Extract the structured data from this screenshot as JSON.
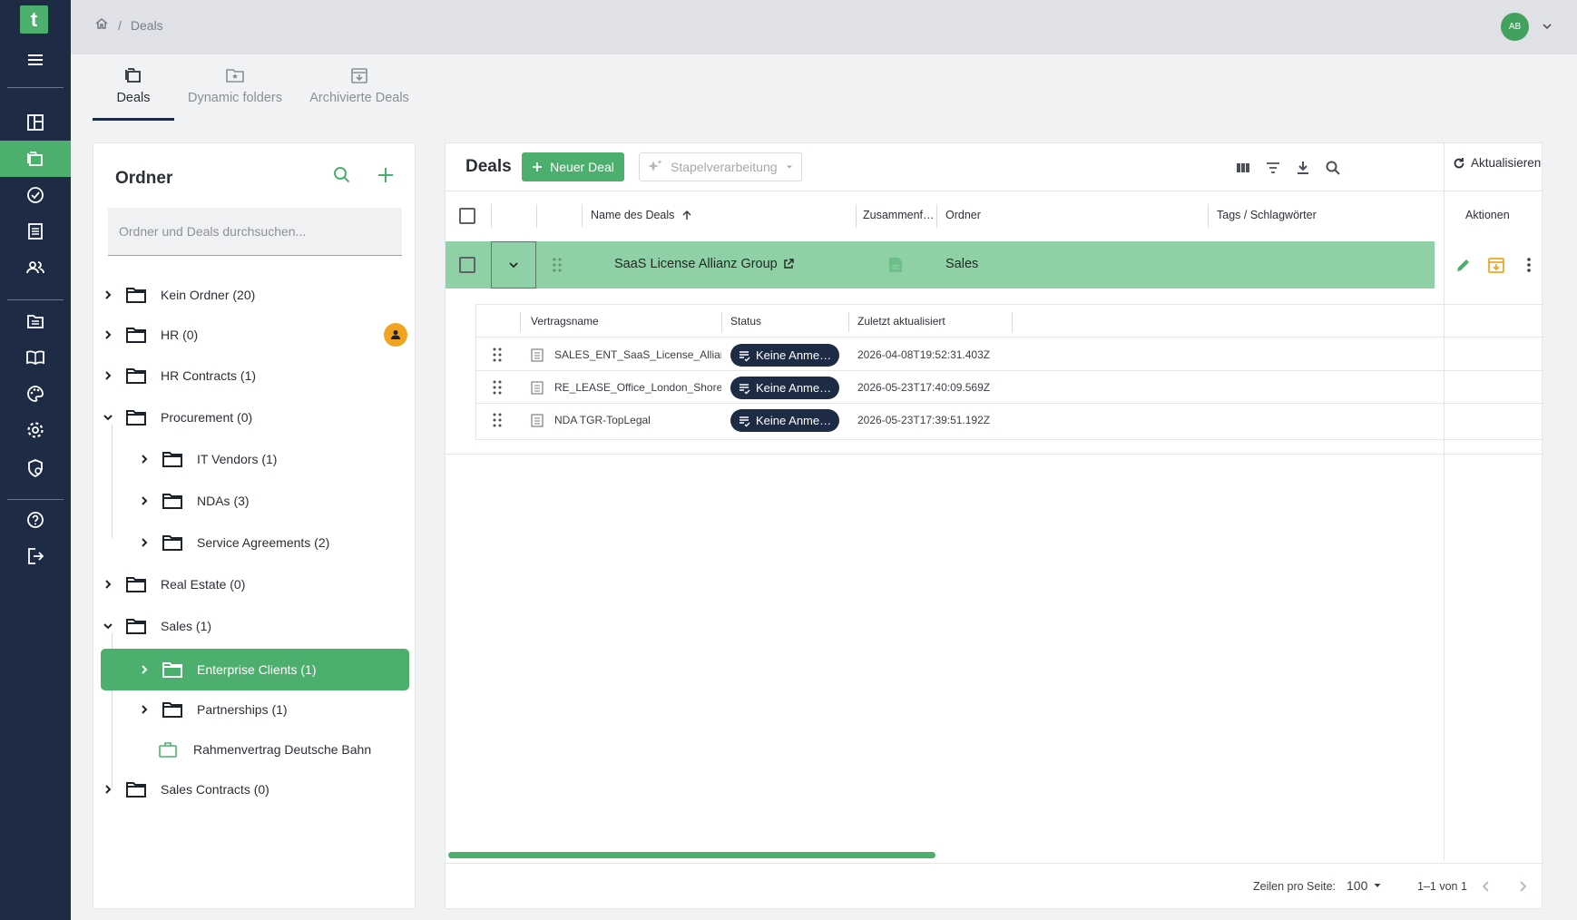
{
  "app": {
    "logo_letter": "t",
    "accent": "#4caf6d",
    "nav_bg": "#1d2b45"
  },
  "nav": {
    "items": [
      "menu-icon",
      "dashboard-icon",
      "deals-icon",
      "tasks-icon",
      "documents-icon",
      "users-icon",
      "templates-icon",
      "library-icon",
      "palette-icon",
      "settings-icon",
      "security-icon",
      "help-icon",
      "logout-icon"
    ],
    "active": "deals-icon"
  },
  "topbar": {
    "breadcrumb_sep": "/",
    "breadcrumb_current": "Deals",
    "avatar_initials": "AB"
  },
  "tabs": [
    {
      "label": "Deals",
      "icon": "deals-folder-icon",
      "active": true
    },
    {
      "label": "Dynamic folders",
      "icon": "dynamic-folder-icon",
      "active": false
    },
    {
      "label": "Archivierte Deals",
      "icon": "archive-icon",
      "active": false
    }
  ],
  "folders": {
    "title": "Ordner",
    "search_placeholder": "Ordner und Deals durchsuchen...",
    "tree": [
      {
        "label": "Kein Ordner (20)",
        "expanded": false,
        "level": 0
      },
      {
        "label": "HR (0)",
        "expanded": false,
        "level": 0,
        "badge": "person-badge-icon"
      },
      {
        "label": "HR Contracts (1)",
        "expanded": false,
        "level": 0
      },
      {
        "label": "Procurement (0)",
        "expanded": true,
        "level": 0
      },
      {
        "label": "IT Vendors (1)",
        "expanded": false,
        "level": 1
      },
      {
        "label": "NDAs (3)",
        "expanded": false,
        "level": 1
      },
      {
        "label": "Service Agreements (2)",
        "expanded": false,
        "level": 1
      },
      {
        "label": "Real Estate (0)",
        "expanded": false,
        "level": 0
      },
      {
        "label": "Sales (1)",
        "expanded": true,
        "level": 0
      },
      {
        "label": "Enterprise Clients (1)",
        "expanded": false,
        "level": 1,
        "selected": true
      },
      {
        "label": "Partnerships (1)",
        "expanded": false,
        "level": 1
      },
      {
        "label": "Rahmenvertrag Deutsche Bahn",
        "level": 1,
        "type": "deal"
      },
      {
        "label": "Sales Contracts (0)",
        "expanded": false,
        "level": 0
      }
    ]
  },
  "deals": {
    "title": "Deals",
    "new_label": "Neuer Deal",
    "batch_label": "Stapelverarbeitung",
    "refresh_label": "Aktualisieren",
    "columns": [
      "Name des Deals",
      "Zusammenf…",
      "Ordner",
      "Tags / Schlagwörter",
      "Aktionen"
    ],
    "row": {
      "name": "SaaS License Allianz Group",
      "folder": "Sales"
    },
    "sub_columns": [
      "Vertragsname",
      "Status",
      "Zuletzt aktualisiert"
    ],
    "contracts": [
      {
        "name": "SALES_ENT_SaaS_License_Allianz_",
        "status": "Keine Anme…",
        "updated": "2026-04-08T19:52:31.403Z"
      },
      {
        "name": "RE_LEASE_Office_London_Shoreditc",
        "status": "Keine Anme…",
        "updated": "2026-05-23T17:40:09.569Z"
      },
      {
        "name": "NDA TGR-TopLegal",
        "status": "Keine Anme…",
        "updated": "2026-05-23T17:39:51.192Z"
      }
    ],
    "footer": {
      "rows_label": "Zeilen pro Seite:",
      "rows_value": "100",
      "range": "1–1 von 1"
    }
  }
}
